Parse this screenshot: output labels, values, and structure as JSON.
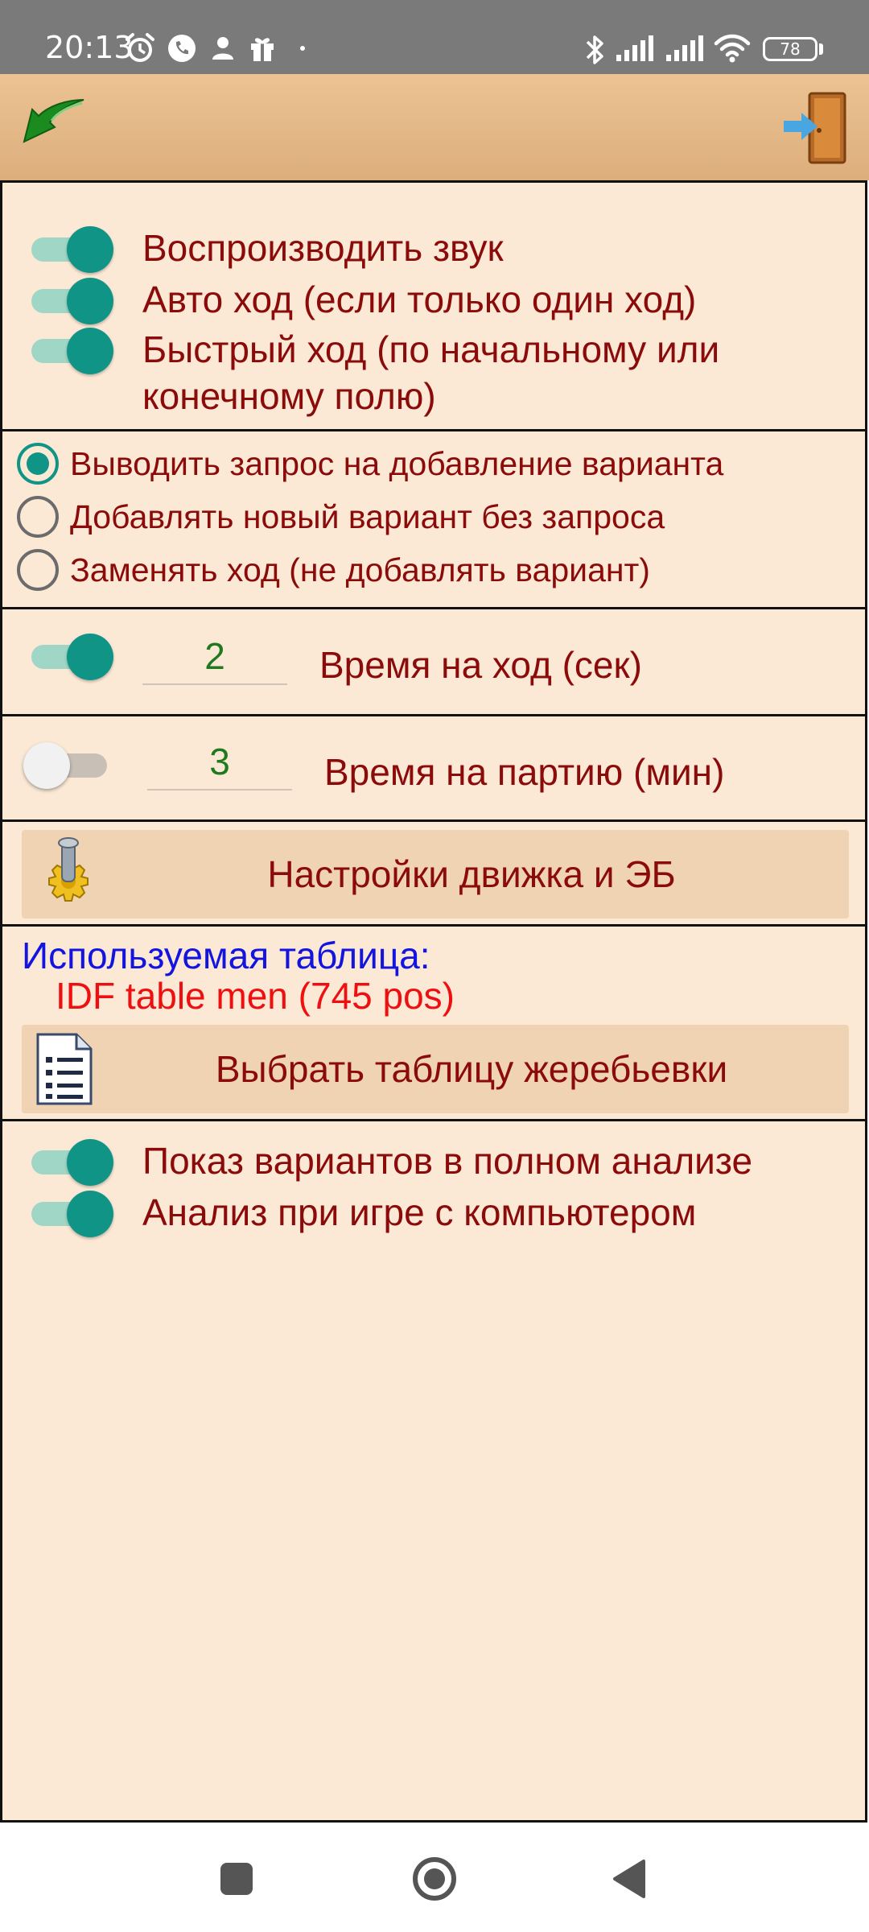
{
  "status_bar": {
    "time": "20:13",
    "battery": "78",
    "icons": [
      "alarm-icon",
      "call-icon",
      "person-icon",
      "gift-icon",
      "dot-icon",
      "bluetooth-icon",
      "signal-icon",
      "signal-icon",
      "wifi-icon",
      "battery-icon"
    ]
  },
  "toolbar": {
    "back_icon": "back-arrow-icon",
    "exit_icon": "exit-door-icon"
  },
  "toggles": [
    {
      "label": "Воспроизводить звук",
      "on": true
    },
    {
      "label": "Авто ход (если только один ход)",
      "on": true
    },
    {
      "label": "Быстрый ход (по начальному или",
      "label_line2": "конечному полю)",
      "on": true
    }
  ],
  "radios": [
    {
      "label": "Выводить запрос на добавление варианта",
      "checked": true
    },
    {
      "label": "Добавлять новый вариант без запроса",
      "checked": false
    },
    {
      "label": "Заменять ход (не добавлять вариант)",
      "checked": false
    }
  ],
  "move_time": {
    "value": "2",
    "label": "Время на ход (сек)",
    "on": true
  },
  "game_time": {
    "value": "3",
    "label": "Время на партию (мин)",
    "on": false
  },
  "engine_button": {
    "label": "Настройки движка и ЭБ",
    "icon": "settings-gear-icon"
  },
  "table": {
    "heading": "Используемая таблица:",
    "name": "IDF table men (745 pos)",
    "button_label": "Выбрать таблицу жеребьевки",
    "button_icon": "document-list-icon"
  },
  "analysis_toggles": [
    {
      "label": "Показ вариантов в полном анализе",
      "on": true
    },
    {
      "label": "Анализ при игре с компьютером",
      "on": true
    }
  ],
  "colors": {
    "accent": "#109486",
    "label_text": "#8b0a0a",
    "background": "#fbe9d6",
    "heading_blue": "#1414e0",
    "table_red": "#ee1010",
    "number_green": "#1f7a1f"
  }
}
